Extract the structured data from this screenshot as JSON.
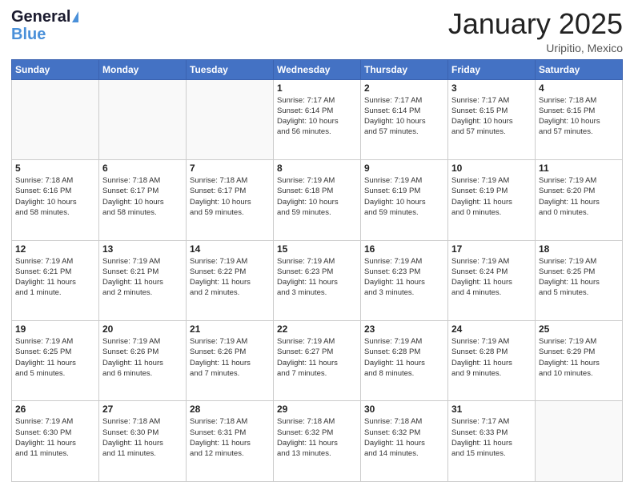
{
  "header": {
    "logo_line1": "General",
    "logo_line2": "Blue",
    "month_title": "January 2025",
    "location": "Uripitio, Mexico"
  },
  "weekdays": [
    "Sunday",
    "Monday",
    "Tuesday",
    "Wednesday",
    "Thursday",
    "Friday",
    "Saturday"
  ],
  "weeks": [
    [
      {
        "day": "",
        "info": ""
      },
      {
        "day": "",
        "info": ""
      },
      {
        "day": "",
        "info": ""
      },
      {
        "day": "1",
        "info": "Sunrise: 7:17 AM\nSunset: 6:14 PM\nDaylight: 10 hours\nand 56 minutes."
      },
      {
        "day": "2",
        "info": "Sunrise: 7:17 AM\nSunset: 6:14 PM\nDaylight: 10 hours\nand 57 minutes."
      },
      {
        "day": "3",
        "info": "Sunrise: 7:17 AM\nSunset: 6:15 PM\nDaylight: 10 hours\nand 57 minutes."
      },
      {
        "day": "4",
        "info": "Sunrise: 7:18 AM\nSunset: 6:15 PM\nDaylight: 10 hours\nand 57 minutes."
      }
    ],
    [
      {
        "day": "5",
        "info": "Sunrise: 7:18 AM\nSunset: 6:16 PM\nDaylight: 10 hours\nand 58 minutes."
      },
      {
        "day": "6",
        "info": "Sunrise: 7:18 AM\nSunset: 6:17 PM\nDaylight: 10 hours\nand 58 minutes."
      },
      {
        "day": "7",
        "info": "Sunrise: 7:18 AM\nSunset: 6:17 PM\nDaylight: 10 hours\nand 59 minutes."
      },
      {
        "day": "8",
        "info": "Sunrise: 7:19 AM\nSunset: 6:18 PM\nDaylight: 10 hours\nand 59 minutes."
      },
      {
        "day": "9",
        "info": "Sunrise: 7:19 AM\nSunset: 6:19 PM\nDaylight: 10 hours\nand 59 minutes."
      },
      {
        "day": "10",
        "info": "Sunrise: 7:19 AM\nSunset: 6:19 PM\nDaylight: 11 hours\nand 0 minutes."
      },
      {
        "day": "11",
        "info": "Sunrise: 7:19 AM\nSunset: 6:20 PM\nDaylight: 11 hours\nand 0 minutes."
      }
    ],
    [
      {
        "day": "12",
        "info": "Sunrise: 7:19 AM\nSunset: 6:21 PM\nDaylight: 11 hours\nand 1 minute."
      },
      {
        "day": "13",
        "info": "Sunrise: 7:19 AM\nSunset: 6:21 PM\nDaylight: 11 hours\nand 2 minutes."
      },
      {
        "day": "14",
        "info": "Sunrise: 7:19 AM\nSunset: 6:22 PM\nDaylight: 11 hours\nand 2 minutes."
      },
      {
        "day": "15",
        "info": "Sunrise: 7:19 AM\nSunset: 6:23 PM\nDaylight: 11 hours\nand 3 minutes."
      },
      {
        "day": "16",
        "info": "Sunrise: 7:19 AM\nSunset: 6:23 PM\nDaylight: 11 hours\nand 3 minutes."
      },
      {
        "day": "17",
        "info": "Sunrise: 7:19 AM\nSunset: 6:24 PM\nDaylight: 11 hours\nand 4 minutes."
      },
      {
        "day": "18",
        "info": "Sunrise: 7:19 AM\nSunset: 6:25 PM\nDaylight: 11 hours\nand 5 minutes."
      }
    ],
    [
      {
        "day": "19",
        "info": "Sunrise: 7:19 AM\nSunset: 6:25 PM\nDaylight: 11 hours\nand 5 minutes."
      },
      {
        "day": "20",
        "info": "Sunrise: 7:19 AM\nSunset: 6:26 PM\nDaylight: 11 hours\nand 6 minutes."
      },
      {
        "day": "21",
        "info": "Sunrise: 7:19 AM\nSunset: 6:26 PM\nDaylight: 11 hours\nand 7 minutes."
      },
      {
        "day": "22",
        "info": "Sunrise: 7:19 AM\nSunset: 6:27 PM\nDaylight: 11 hours\nand 7 minutes."
      },
      {
        "day": "23",
        "info": "Sunrise: 7:19 AM\nSunset: 6:28 PM\nDaylight: 11 hours\nand 8 minutes."
      },
      {
        "day": "24",
        "info": "Sunrise: 7:19 AM\nSunset: 6:28 PM\nDaylight: 11 hours\nand 9 minutes."
      },
      {
        "day": "25",
        "info": "Sunrise: 7:19 AM\nSunset: 6:29 PM\nDaylight: 11 hours\nand 10 minutes."
      }
    ],
    [
      {
        "day": "26",
        "info": "Sunrise: 7:19 AM\nSunset: 6:30 PM\nDaylight: 11 hours\nand 11 minutes."
      },
      {
        "day": "27",
        "info": "Sunrise: 7:18 AM\nSunset: 6:30 PM\nDaylight: 11 hours\nand 11 minutes."
      },
      {
        "day": "28",
        "info": "Sunrise: 7:18 AM\nSunset: 6:31 PM\nDaylight: 11 hours\nand 12 minutes."
      },
      {
        "day": "29",
        "info": "Sunrise: 7:18 AM\nSunset: 6:32 PM\nDaylight: 11 hours\nand 13 minutes."
      },
      {
        "day": "30",
        "info": "Sunrise: 7:18 AM\nSunset: 6:32 PM\nDaylight: 11 hours\nand 14 minutes."
      },
      {
        "day": "31",
        "info": "Sunrise: 7:17 AM\nSunset: 6:33 PM\nDaylight: 11 hours\nand 15 minutes."
      },
      {
        "day": "",
        "info": ""
      }
    ]
  ]
}
